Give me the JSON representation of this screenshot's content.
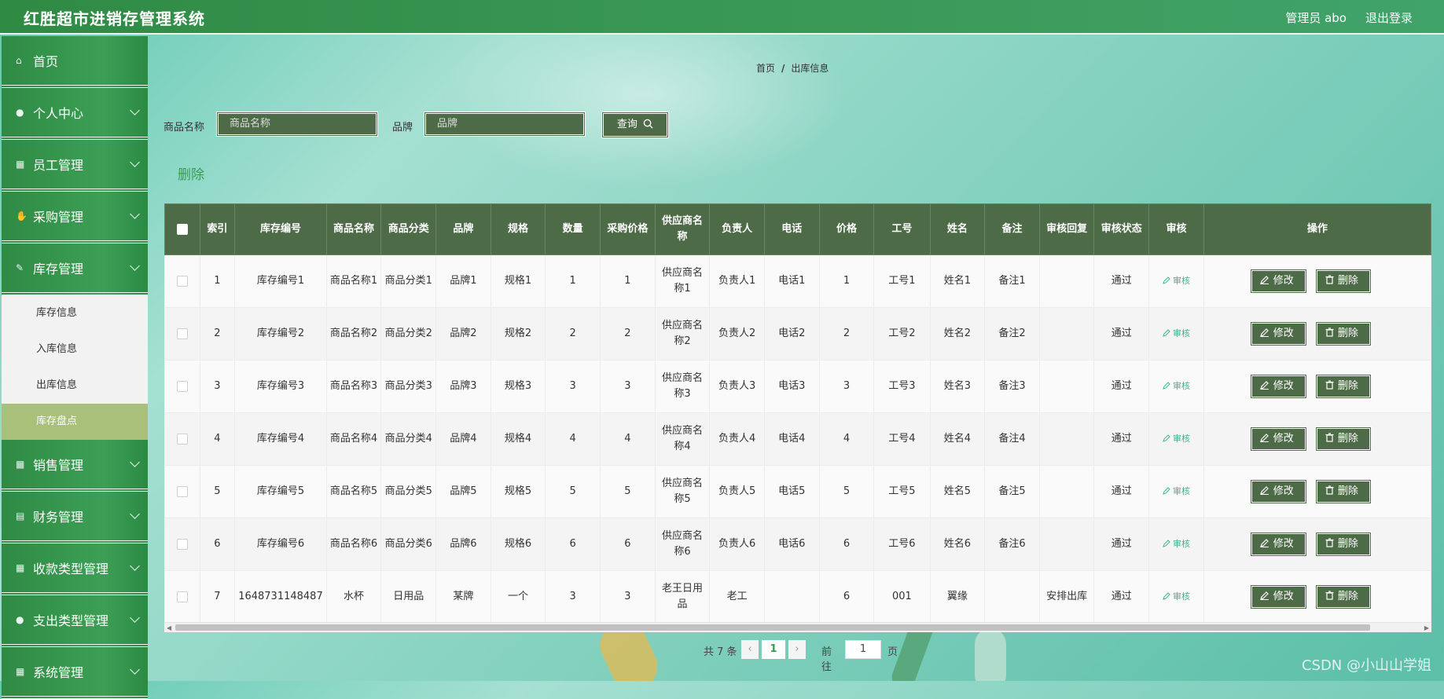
{
  "header": {
    "title": "红胜超市进销存管理系统",
    "user": "管理员 abo",
    "logout": "退出登录"
  },
  "sidebar": {
    "items": [
      {
        "label": "首页",
        "icon": "home-icon",
        "glyph": "⌂",
        "expandable": false
      },
      {
        "label": "个人中心",
        "icon": "user-icon",
        "glyph": "●",
        "expandable": true
      },
      {
        "label": "员工管理",
        "icon": "grid-icon",
        "glyph": "▦",
        "expandable": true
      },
      {
        "label": "采购管理",
        "icon": "thumb-icon",
        "glyph": "✋",
        "expandable": true
      },
      {
        "label": "库存管理",
        "icon": "edit-icon",
        "glyph": "✎",
        "expandable": true,
        "expanded": true,
        "children": [
          "库存信息",
          "入库信息",
          "出库信息",
          "库存盘点"
        ],
        "active_child": "库存盘点"
      },
      {
        "label": "销售管理",
        "icon": "grid-icon",
        "glyph": "▦",
        "expandable": true
      },
      {
        "label": "财务管理",
        "icon": "clipboard-icon",
        "glyph": "▤",
        "expandable": true
      },
      {
        "label": "收款类型管理",
        "icon": "grid-icon",
        "glyph": "▦",
        "expandable": true
      },
      {
        "label": "支出类型管理",
        "icon": "user-icon",
        "glyph": "●",
        "expandable": true
      },
      {
        "label": "系统管理",
        "icon": "grid-icon",
        "glyph": "▦",
        "expandable": true
      }
    ]
  },
  "breadcrumb": {
    "home": "首页",
    "sep": "/",
    "current": "出库信息"
  },
  "search": {
    "name_label": "商品名称",
    "name_placeholder": "商品名称",
    "brand_label": "品牌",
    "brand_placeholder": "品牌",
    "button": "查询"
  },
  "delete_link": "删除",
  "table": {
    "columns": [
      "索引",
      "库存编号",
      "商品名称",
      "商品分类",
      "品牌",
      "规格",
      "数量",
      "采购价格",
      "供应商名称",
      "负责人",
      "电话",
      "价格",
      "工号",
      "姓名",
      "备注",
      "审核回复",
      "审核状态",
      "审核",
      "操作"
    ],
    "audit_label": "审核",
    "edit_label": "修改",
    "delete_label": "删除",
    "rows": [
      [
        "1",
        "库存编号1",
        "商品名称1",
        "商品分类1",
        "品牌1",
        "规格1",
        "1",
        "1",
        "供应商名称1",
        "负责人1",
        "电话1",
        "1",
        "工号1",
        "姓名1",
        "备注1",
        "",
        "通过"
      ],
      [
        "2",
        "库存编号2",
        "商品名称2",
        "商品分类2",
        "品牌2",
        "规格2",
        "2",
        "2",
        "供应商名称2",
        "负责人2",
        "电话2",
        "2",
        "工号2",
        "姓名2",
        "备注2",
        "",
        "通过"
      ],
      [
        "3",
        "库存编号3",
        "商品名称3",
        "商品分类3",
        "品牌3",
        "规格3",
        "3",
        "3",
        "供应商名称3",
        "负责人3",
        "电话3",
        "3",
        "工号3",
        "姓名3",
        "备注3",
        "",
        "通过"
      ],
      [
        "4",
        "库存编号4",
        "商品名称4",
        "商品分类4",
        "品牌4",
        "规格4",
        "4",
        "4",
        "供应商名称4",
        "负责人4",
        "电话4",
        "4",
        "工号4",
        "姓名4",
        "备注4",
        "",
        "通过"
      ],
      [
        "5",
        "库存编号5",
        "商品名称5",
        "商品分类5",
        "品牌5",
        "规格5",
        "5",
        "5",
        "供应商名称5",
        "负责人5",
        "电话5",
        "5",
        "工号5",
        "姓名5",
        "备注5",
        "",
        "通过"
      ],
      [
        "6",
        "库存编号6",
        "商品名称6",
        "商品分类6",
        "品牌6",
        "规格6",
        "6",
        "6",
        "供应商名称6",
        "负责人6",
        "电话6",
        "6",
        "工号6",
        "姓名6",
        "备注6",
        "",
        "通过"
      ],
      [
        "7",
        "1648731148487",
        "水杯",
        "日用品",
        "某牌",
        "一个",
        "3",
        "3",
        "老王日用品",
        "老工",
        "",
        "6",
        "001",
        "翼缘",
        "",
        "安排出库",
        "通过"
      ]
    ]
  },
  "pagination": {
    "total_text": "共 7 条",
    "current_page": "1",
    "goto_label": "前往",
    "goto_value": "1",
    "goto_unit": "页"
  },
  "watermark": "CSDN @小山山学姐",
  "colors": {
    "accent": "#3b9a58",
    "table_header": "#4e6b48",
    "active_submenu": "#a8c07a",
    "audit_link": "#3fb68a"
  }
}
